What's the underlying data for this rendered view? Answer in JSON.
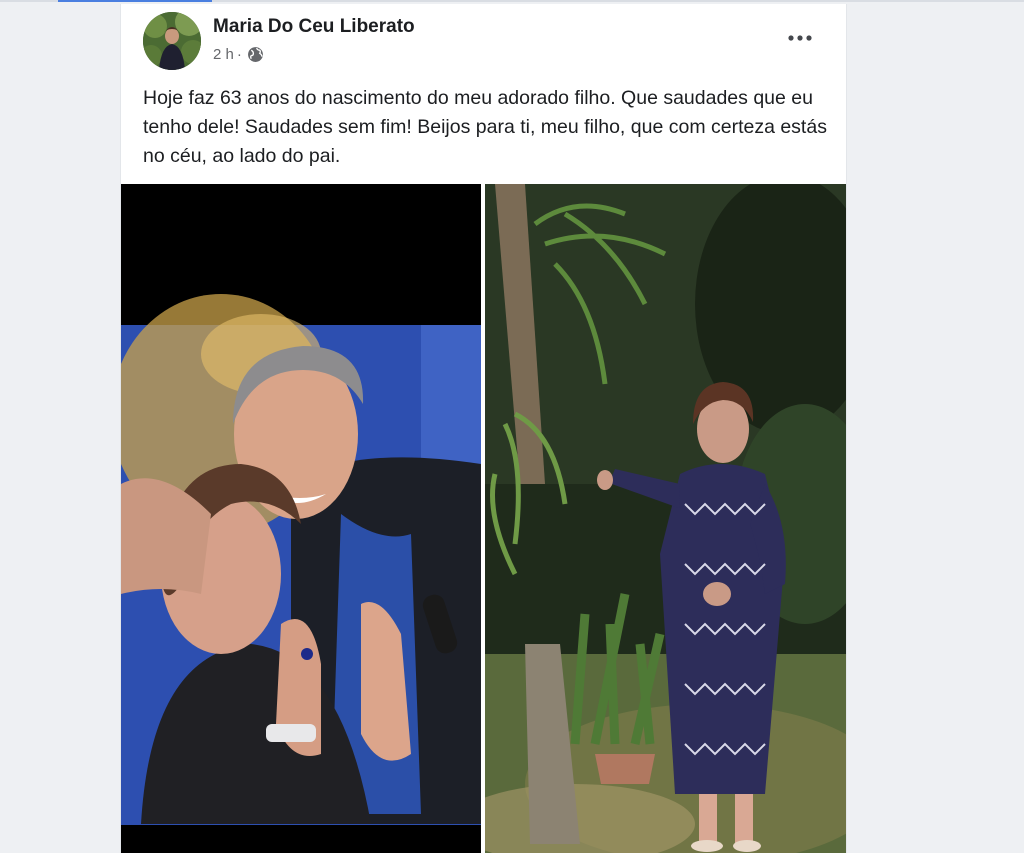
{
  "post": {
    "author": "Maria Do Ceu Liberato",
    "time": "2 h",
    "separator": "·",
    "privacy_icon": "globe-icon",
    "more_icon": "more-options-icon",
    "text": "Hoje faz 63 anos do nascimento do meu adorado filho. Que saudades que eu tenho dele! Saudades sem fim! Beijos para ti, meu filho, que com certeza estás no céu, ao lado do pai.",
    "photos": [
      {
        "name": "photo-mother-and-son"
      },
      {
        "name": "photo-woman-in-garden"
      }
    ]
  },
  "colors": {
    "accent": "#4a7fe0",
    "text": "#1c1e21",
    "secondary_text": "#65676b",
    "background": "#eef0f3",
    "card": "#ffffff"
  }
}
